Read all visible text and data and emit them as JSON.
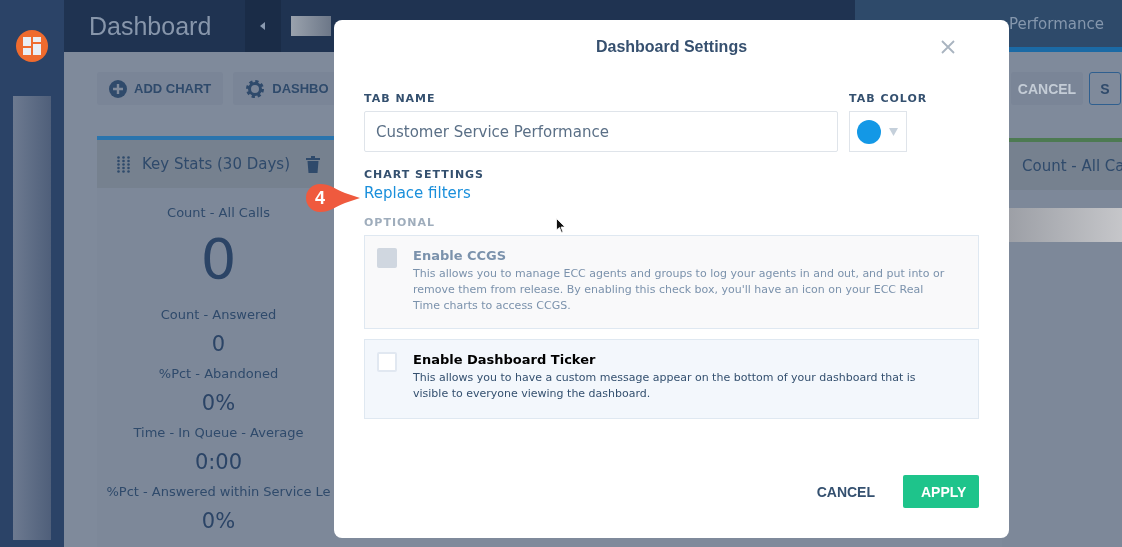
{
  "app": {
    "title": "Dashboard",
    "tab": "Performance"
  },
  "toolbar": {
    "buttons": [
      {
        "label": "ADD CHART",
        "kind": "add"
      },
      {
        "label": "DASHBO",
        "kind": "settings"
      }
    ],
    "right_buttons": [
      {
        "label": "CANCEL",
        "disabled": true
      },
      {
        "label": "S",
        "disabled": false
      }
    ]
  },
  "cards": [
    {
      "title": "Key Stats (30 Days)",
      "stats": [
        {
          "label": "Count - All Calls",
          "value": "0",
          "kind": "large"
        },
        {
          "label": "Count - Answered",
          "value": "0",
          "kind": "normal"
        },
        {
          "label": "%Pct - Abandoned",
          "value": "0%",
          "kind": "normal"
        },
        {
          "label": "Time - In Queue - Average",
          "value": "0:00",
          "kind": "normal"
        },
        {
          "label": "%Pct - Answered within Service Le",
          "value": "0%",
          "kind": "normal"
        }
      ]
    },
    {
      "title": "Count - All Ca"
    }
  ],
  "dialog": {
    "title": "Dashboard Settings",
    "tab_name_label": "TAB NAME",
    "tab_name": "Customer Service Performance",
    "tab_color_label": "TAB COLOR",
    "chart_settings_label": "CHART SETTINGS",
    "link": "Replace filters",
    "step": "4",
    "optional_label": "OPTIONAL",
    "options": [
      {
        "title": "Enable CCGS",
        "description": "This allows you to manage ECC agents and groups to log your agents in and out, and put into or remove them from release. By enabling this check box, you'll have an icon on your ECC Real Time charts to access CCGS.",
        "checked": false,
        "disabled": true
      },
      {
        "title": "Enable Dashboard Ticker",
        "description": "This allows you to have a custom message appear on the bottom of your dashboard that is visible to everyone viewing the dashboard.",
        "checked": false,
        "disabled": false
      }
    ],
    "buttons": [
      {
        "label": "CANCEL",
        "kind": "secondary"
      },
      {
        "label": "APPLY",
        "kind": "primary"
      }
    ]
  }
}
